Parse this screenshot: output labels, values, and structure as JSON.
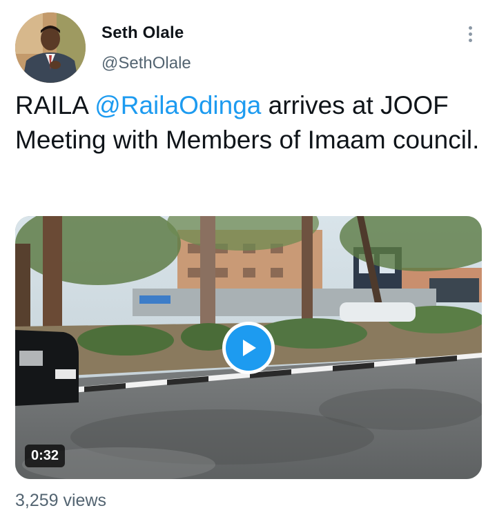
{
  "author": {
    "name": "Seth Olale",
    "handle": "@SethOlale"
  },
  "more_icon": "more-vertical-icon",
  "tweet": {
    "text_prefix": "RAILA ",
    "mention": "@RailaOdinga",
    "text_suffix": " arrives at JOOF Meeting with Members of Imaam council."
  },
  "media": {
    "type": "video",
    "duration": "0:32",
    "play_icon": "play-icon"
  },
  "stats": {
    "views": "3,259 views"
  },
  "colors": {
    "accent": "#1d9bf0",
    "text": "#0f1419",
    "secondary": "#536471"
  }
}
